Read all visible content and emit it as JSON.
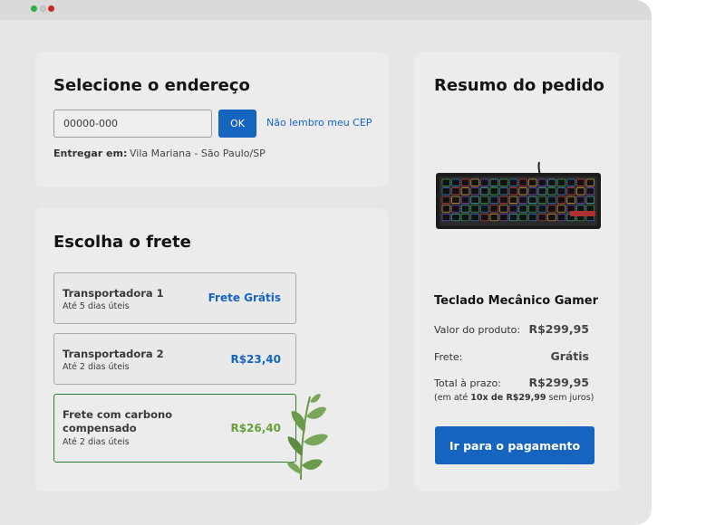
{
  "window": {
    "controls": [
      "close-green",
      "minimize",
      "maximize-red"
    ]
  },
  "address": {
    "title": "Selecione o endereço",
    "cep_placeholder": "00000-000",
    "ok_label": "OK",
    "forgot_cep_label": "Não lembro meu CEP",
    "deliver_to_label": "Entregar em:",
    "deliver_to_value": "Vila Mariana - São Paulo/SP"
  },
  "shipping": {
    "title": "Escolha o frete",
    "options": [
      {
        "name": "Transportadora 1",
        "days": "Até 5 dias úteis",
        "price": "Frete Grátis",
        "selected": false
      },
      {
        "name": "Transportadora 2",
        "days": "Até 2 dias úteis",
        "price": "R$23,40",
        "selected": false
      },
      {
        "name_line1": "Frete com carbono",
        "name_line2": "compensado",
        "days": "Até 2 dias úteis",
        "price": "R$26,40",
        "selected": true
      }
    ],
    "accent_colors": {
      "blue": "#1565c0",
      "green": "#689f38",
      "selected_border": "#2e7d32"
    }
  },
  "summary": {
    "title": "Resumo do pedido",
    "product_image_icon": "keyboard-product-image",
    "product_name": "Teclado Mecânico Gamer",
    "product_value_label": "Valor do produto:",
    "product_value": "R$299,95",
    "shipping_label": "Frete:",
    "shipping_value": "Grátis",
    "total_label": "Total à prazo:",
    "total_value": "R$299,95",
    "installments_prefix": "(em até",
    "installments_bold": "10x de R$29,99",
    "installments_suffix": "sem juros)",
    "pay_button": "Ir para o pagamento"
  }
}
